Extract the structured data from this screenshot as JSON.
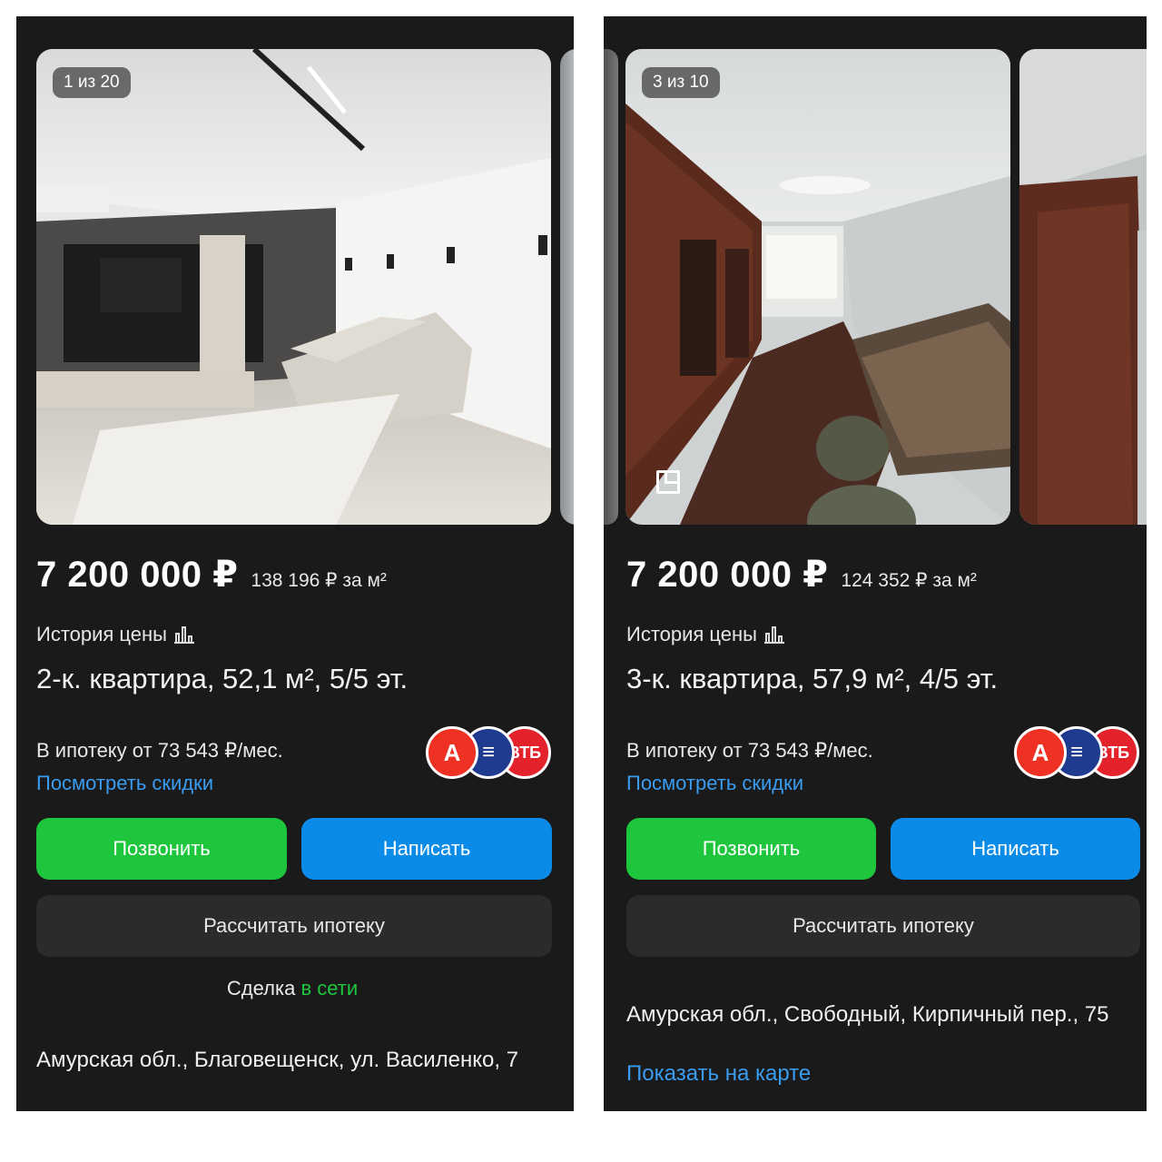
{
  "colors": {
    "panel_bg": "#1a1a1a",
    "call_button": "#1ec63d",
    "write_button": "#0a8be8",
    "link": "#3a9cf0",
    "calc_button": "#2b2b2b"
  },
  "listings": [
    {
      "gallery": {
        "counter": "1 из 20",
        "icon": "plan-icon"
      },
      "price": "7 200 000 ₽",
      "price_per_m2": "138 196 ₽ за м²",
      "price_history_label": "История цены",
      "title": "2-к. квартира, 52,1 м², 5/5 эт.",
      "mortgage_text": "В ипотеку от 73 543 ₽/мес.",
      "discounts_link": "Посмотреть скидки",
      "banks": [
        "А",
        "≡",
        "ВТБ"
      ],
      "call_label": "Позвонить",
      "write_label": "Написать",
      "calc_label": "Рассчитать ипотеку",
      "deal_label": "Сделка",
      "deal_online": "в сети",
      "address": "Амурская обл., Благовещенск, ул. Василенко, 7"
    },
    {
      "gallery": {
        "counter": "3 из 10",
        "icon": "plan-icon"
      },
      "price": "7 200 000 ₽",
      "price_per_m2": "124 352 ₽ за м²",
      "price_history_label": "История цены",
      "title": "3-к. квартира, 57,9 м², 4/5 эт.",
      "mortgage_text": "В ипотеку от 73 543 ₽/мес.",
      "discounts_link": "Посмотреть скидки",
      "banks": [
        "А",
        "≡",
        "ВТБ"
      ],
      "call_label": "Позвонить",
      "write_label": "Написать",
      "calc_label": "Рассчитать ипотеку",
      "address": "Амурская обл., Свободный, Кирпичный пер., 75",
      "map_link": "Показать на карте"
    }
  ]
}
